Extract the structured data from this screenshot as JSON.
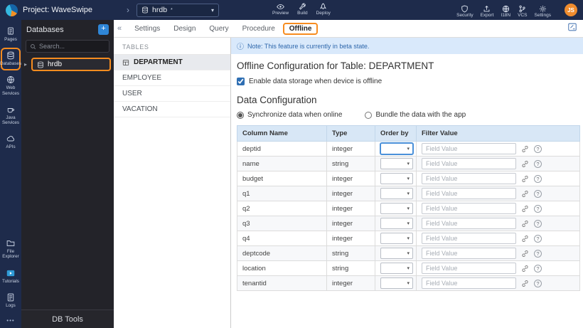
{
  "topbar": {
    "project_label": "Project: WaveSwipe",
    "db_selector": {
      "value": "hrdb",
      "modified_mark": "*"
    },
    "actions": {
      "preview": "Preview",
      "build": "Build",
      "deploy": "Deploy",
      "security": "Security",
      "export": "Export",
      "i18n": "I18N",
      "vcs": "VCS",
      "settings": "Settings"
    },
    "avatar_initials": "JS"
  },
  "sidebar": {
    "items": [
      {
        "label": "Pages"
      },
      {
        "label": "Databases",
        "active": true
      },
      {
        "label": "Web Services"
      },
      {
        "label": "Java Services"
      },
      {
        "label": "APIs"
      },
      {
        "label": "File Explorer"
      },
      {
        "label": "Tutorials"
      },
      {
        "label": "Logs"
      }
    ],
    "more": "•••"
  },
  "db_panel": {
    "title": "Databases",
    "add_label": "+",
    "search_placeholder": "Search...",
    "tree": [
      {
        "label": "hrdb",
        "selected": true
      }
    ],
    "footer": "DB Tools"
  },
  "tabs": {
    "items": [
      "Settings",
      "Design",
      "Query",
      "Procedure",
      "Offline"
    ],
    "active": "Offline"
  },
  "tables_panel": {
    "title": "TABLES",
    "items": [
      {
        "label": "DEPARTMENT",
        "selected": true
      },
      {
        "label": "EMPLOYEE"
      },
      {
        "label": "USER"
      },
      {
        "label": "VACATION"
      }
    ]
  },
  "offline": {
    "note": "Note: This feature is currently in beta state.",
    "title": "Offline Configuration for Table: DEPARTMENT",
    "enable_label": "Enable data storage when device is offline",
    "enable_checked": true,
    "section_title": "Data Configuration",
    "options": [
      {
        "label": "Synchronize data when online",
        "selected": true
      },
      {
        "label": "Bundle the data with the app",
        "selected": false
      }
    ],
    "table": {
      "headers": [
        "Column Name",
        "Type",
        "Order by",
        "Filter Value"
      ],
      "filter_placeholder": "Field Value",
      "rows": [
        {
          "name": "deptid",
          "type": "integer"
        },
        {
          "name": "name",
          "type": "string"
        },
        {
          "name": "budget",
          "type": "integer"
        },
        {
          "name": "q1",
          "type": "integer"
        },
        {
          "name": "q2",
          "type": "integer"
        },
        {
          "name": "q3",
          "type": "integer"
        },
        {
          "name": "q4",
          "type": "integer"
        },
        {
          "name": "deptcode",
          "type": "string"
        },
        {
          "name": "location",
          "type": "string"
        },
        {
          "name": "tenantid",
          "type": "integer"
        }
      ]
    }
  },
  "glyphs": {
    "collapse": "«",
    "caret_down": "▾",
    "breadcrumb_chevron": "›",
    "expander": "▸",
    "info": "ⓘ",
    "help": "?"
  },
  "colors": {
    "accent_orange": "#f78c1f",
    "topbar_navy": "#1e2b4b",
    "panel_dark": "#232329",
    "note_blue_bg": "#d9e9fb",
    "table_header_bg": "#d8e7f6",
    "primary_blue": "#2f86d6",
    "avatar_orange": "#ef8c2e"
  }
}
